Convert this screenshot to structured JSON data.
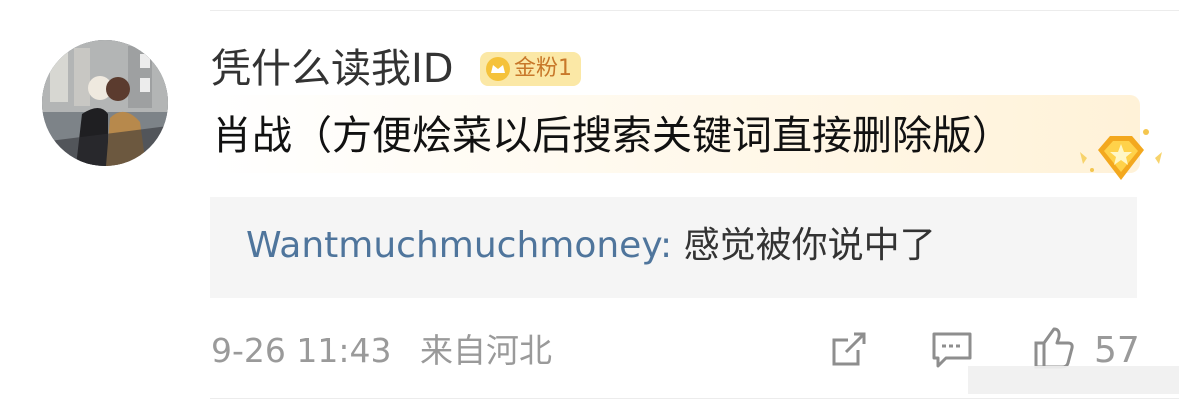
{
  "comment": {
    "username": "凭什么读我ID",
    "badge": {
      "label": "金粉1"
    },
    "text": "肖战（方便烩菜以后搜索关键词直接删除版）",
    "reply": {
      "user": "Wantmuchmuchmoney:",
      "content": "感觉被你说中了"
    },
    "meta": {
      "date_time": "9-26 11:43",
      "location": "来自河北"
    },
    "actions": {
      "share_icon": "share-icon",
      "comment_icon": "comment-icon",
      "like_icon": "like-icon",
      "like_count": "57"
    }
  },
  "colors": {
    "username": "#333333",
    "reply_user": "#4f759c",
    "meta": "#9a9a9a",
    "badge_text": "#c8782a",
    "badge_bg": "#fbe8a6"
  }
}
